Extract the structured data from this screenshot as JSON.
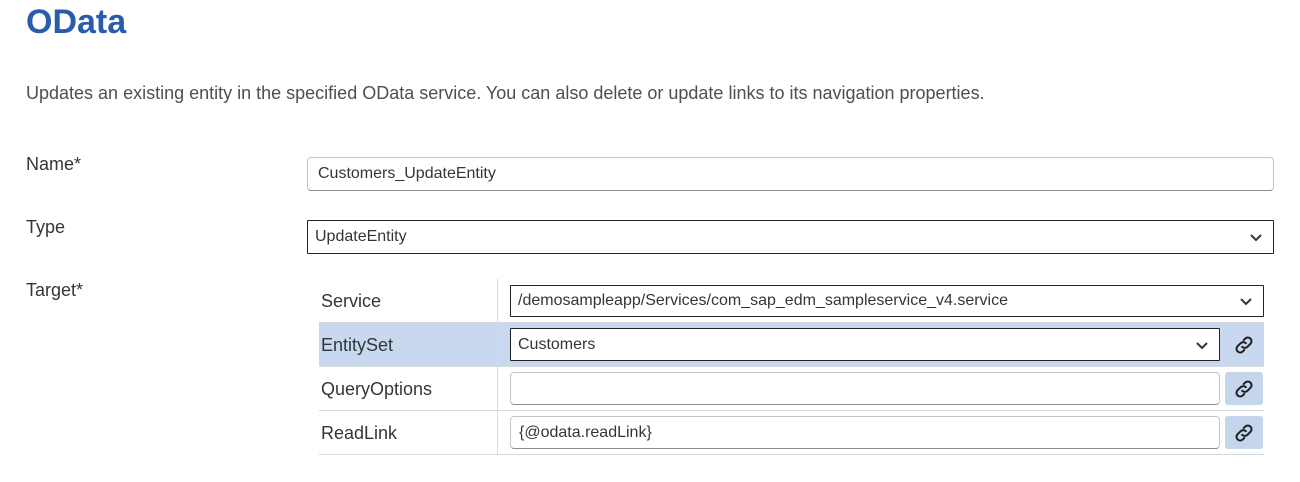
{
  "page": {
    "title": "OData",
    "description": "Updates an existing entity in the specified OData service. You can also delete or update links to its navigation properties."
  },
  "form": {
    "name": {
      "label": "Name*",
      "value": "Customers_UpdateEntity"
    },
    "type": {
      "label": "Type",
      "value": "UpdateEntity"
    },
    "target": {
      "label": "Target*",
      "rows": [
        {
          "key": "Service",
          "value": "/demosampleapp/Services/com_sap_edm_sampleservice_v4.service"
        },
        {
          "key": "EntitySet",
          "value": "Customers"
        },
        {
          "key": "QueryOptions",
          "value": ""
        },
        {
          "key": "ReadLink",
          "value": "{@odata.readLink}"
        }
      ]
    }
  },
  "icons": {
    "dropdown": "chevron-down-icon",
    "bind": "link-icon"
  },
  "colors": {
    "title": "#2b5cab",
    "selected_row": "#c8d8ee",
    "link_button": "#c4d5ec"
  }
}
